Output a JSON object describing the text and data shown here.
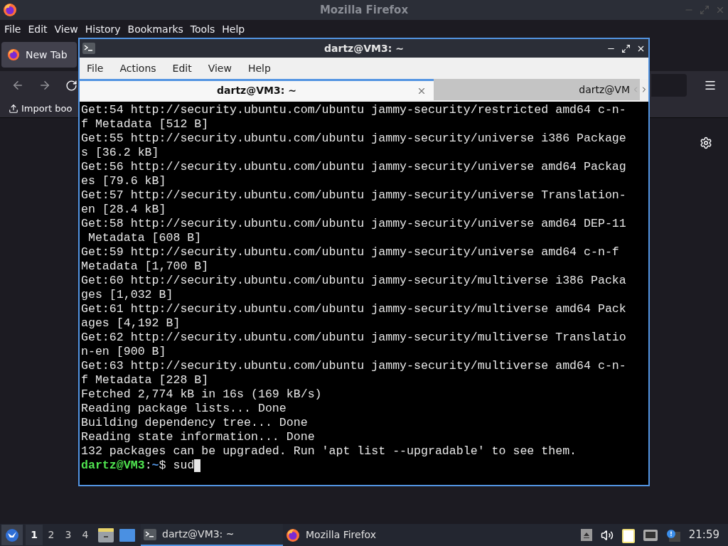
{
  "firefox": {
    "title": "Mozilla Firefox",
    "menu": [
      "File",
      "Edit",
      "View",
      "History",
      "Bookmarks",
      "Tools",
      "Help"
    ],
    "tabs": [
      {
        "label": "New Tab",
        "selected": true
      }
    ],
    "bookmarks": [
      "Import boo"
    ]
  },
  "terminal": {
    "title": "dartz@VM3: ~",
    "menu": [
      "File",
      "Actions",
      "Edit",
      "View",
      "Help"
    ],
    "tabs": [
      {
        "label": "dartz@VM3: ~",
        "selected": true
      },
      {
        "label": "dartz@VM",
        "selected": false
      }
    ],
    "lines": [
      "Get:54 http://security.ubuntu.com/ubuntu jammy-security/restricted amd64 c-n-",
      "f Metadata [512 B]",
      "Get:55 http://security.ubuntu.com/ubuntu jammy-security/universe i386 Package",
      "s [36.2 kB]",
      "Get:56 http://security.ubuntu.com/ubuntu jammy-security/universe amd64 Packag",
      "es [79.6 kB]",
      "Get:57 http://security.ubuntu.com/ubuntu jammy-security/universe Translation-",
      "en [28.4 kB]",
      "Get:58 http://security.ubuntu.com/ubuntu jammy-security/universe amd64 DEP-11",
      " Metadata [608 B]",
      "Get:59 http://security.ubuntu.com/ubuntu jammy-security/universe amd64 c-n-f",
      "Metadata [1,700 B]",
      "Get:60 http://security.ubuntu.com/ubuntu jammy-security/multiverse i386 Packa",
      "ges [1,032 B]",
      "Get:61 http://security.ubuntu.com/ubuntu jammy-security/multiverse amd64 Pack",
      "ages [4,192 B]",
      "Get:62 http://security.ubuntu.com/ubuntu jammy-security/multiverse Translatio",
      "n-en [900 B]",
      "Get:63 http://security.ubuntu.com/ubuntu jammy-security/multiverse amd64 c-n-",
      "f Metadata [228 B]",
      "Fetched 2,774 kB in 16s (169 kB/s)",
      "Reading package lists... Done",
      "Building dependency tree... Done",
      "Reading state information... Done",
      "132 packages can be upgraded. Run 'apt list --upgradable' to see them."
    ],
    "prompt": {
      "user_host": "dartz@VM3",
      "separator": ":",
      "path": "~",
      "symbol": "$",
      "command": "sud"
    }
  },
  "taskbar": {
    "workspaces": [
      {
        "label": "1",
        "selected": true
      },
      {
        "label": "2",
        "selected": false
      },
      {
        "label": "3",
        "selected": false
      },
      {
        "label": "4",
        "selected": false
      }
    ],
    "tasks": [
      {
        "kind": "terminal",
        "label": "dartz@VM3: ~",
        "selected": true
      },
      {
        "kind": "firefox",
        "label": "Mozilla Firefox",
        "selected": false
      }
    ],
    "clock": "21:59"
  }
}
